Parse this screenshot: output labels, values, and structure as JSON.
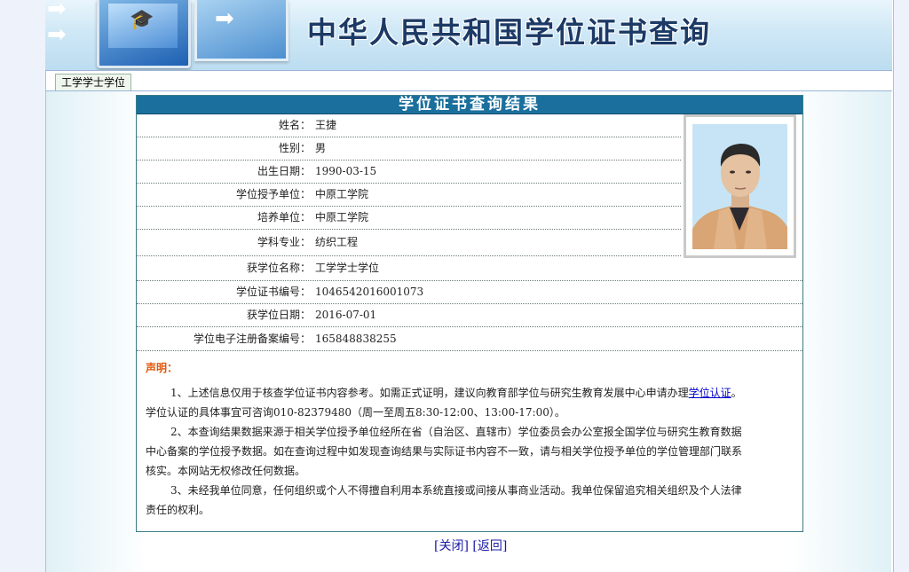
{
  "header": {
    "title": "中华人民共和国学位证书查询"
  },
  "tabs": [
    {
      "label": "工学学士学位"
    }
  ],
  "panel": {
    "title": "学位证书查询结果"
  },
  "record": [
    {
      "label": "姓名：",
      "value": "王捷"
    },
    {
      "label": "性别：",
      "value": "男"
    },
    {
      "label": "出生日期：",
      "value": "1990-03-15"
    },
    {
      "label": "学位授予单位：",
      "value": "中原工学院"
    },
    {
      "label": "培养单位：",
      "value": "中原工学院"
    },
    {
      "label": "学科专业：",
      "value": "纺织工程"
    },
    {
      "label": "获学位名称：",
      "value": "工学学士学位"
    },
    {
      "label": "学位证书编号：",
      "value": "1046542016001073"
    },
    {
      "label": "获学位日期：",
      "value": "2016-07-01"
    },
    {
      "label": "学位电子注册备案编号：",
      "value": "165848838255"
    }
  ],
  "notice": {
    "heading": "声明：",
    "p1_pre": "1、上述信息仅用于核查学位证书内容参考。如需正式证明，建议向教育部学位与研究生教育发展中心申请办理",
    "p1_link": "学位认证",
    "p1_post": "。",
    "p1_line2": "学位认证的具体事宜可咨询010-82379480（周一至周五8:30-12:00、13:00-17:00）。",
    "p2": "2、本查询结果数据来源于相关学位授予单位经所在省（自治区、直辖市）学位委员会办公室报全国学位与研究生教育数据",
    "p2_line2": "中心备案的学位授予数据。如在查询过程中如发现查询结果与实际证书内容不一致，请与相关学位授予单位的学位管理部门联系",
    "p2_line3": "核实。本网站无权修改任何数据。",
    "p3": "3、未经我单位同意，任何组织或个人不得擅自利用本系统直接或间接从事商业活动。我单位保留追究相关组织及个人法律",
    "p3_line2": "责任的权利。"
  },
  "footer": {
    "close_label": "[关闭]",
    "back_label": "[返回]"
  }
}
